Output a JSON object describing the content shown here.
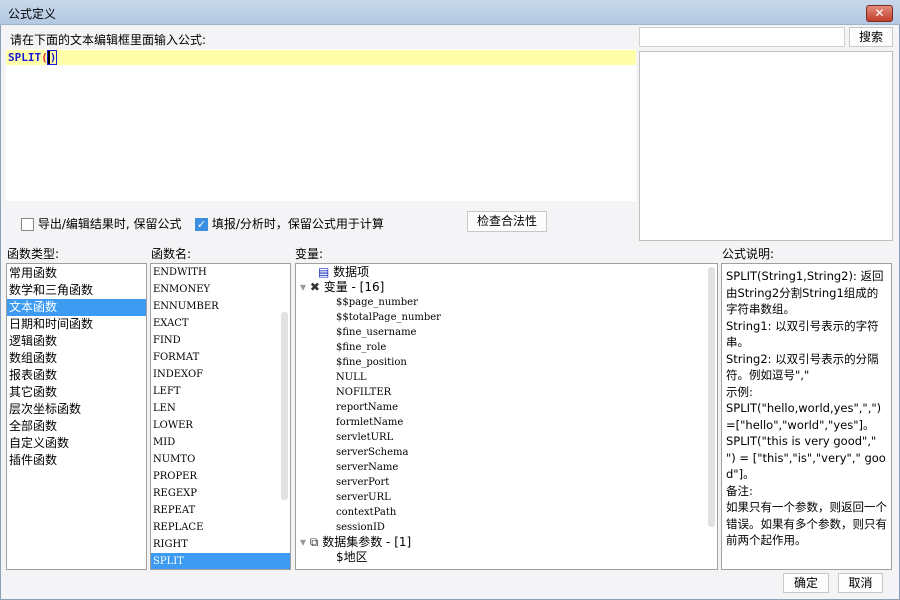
{
  "window": {
    "title": "公式定义",
    "close_icon": "close-icon"
  },
  "editor": {
    "label": "请在下面的文本编辑框里面输入公式:",
    "formula_name": "SPLIT",
    "formula_open": "(",
    "formula_close": ")"
  },
  "search": {
    "value": "",
    "button": "搜索"
  },
  "options": {
    "keep_formula_export": {
      "label": "导出/编辑结果时, 保留公式",
      "checked": false
    },
    "keep_formula_fill": {
      "label": "填报/分析时，保留公式用于计算",
      "checked": true
    },
    "check_button": "检查合法性"
  },
  "labels": {
    "func_type": "函数类型:",
    "func_name": "函数名:",
    "variables": "变量:",
    "description": "公式说明:"
  },
  "func_types": [
    "常用函数",
    "数学和三角函数",
    "文本函数",
    "日期和时间函数",
    "逻辑函数",
    "数组函数",
    "报表函数",
    "其它函数",
    "层次坐标函数",
    "全部函数",
    "自定义函数",
    "插件函数"
  ],
  "func_types_selected": 2,
  "func_names": [
    "ENDWITH",
    "ENMONEY",
    "ENNUMBER",
    "EXACT",
    "FIND",
    "FORMAT",
    "INDEXOF",
    "LEFT",
    "LEN",
    "LOWER",
    "MID",
    "NUMTO",
    "PROPER",
    "REGEXP",
    "REPEAT",
    "REPLACE",
    "RIGHT",
    "SPLIT"
  ],
  "func_names_selected": 17,
  "tree": {
    "data_items": "数据项",
    "variables_group": "变量 - [16]",
    "variables": [
      "$$page_number",
      "$$totalPage_number",
      "$fine_username",
      "$fine_role",
      "$fine_position",
      "NULL",
      "NOFILTER",
      "reportName",
      "formletName",
      "servletURL",
      "serverSchema",
      "serverName",
      "serverPort",
      "serverURL",
      "contextPath",
      "sessionID"
    ],
    "dataset_group": "数据集参数 - [1]",
    "dataset_params": [
      "$地区"
    ]
  },
  "description": [
    "SPLIT(String1,String2): 返回由String2分割String1组成的字符串数组。",
    "String1: 以双引号表示的字符串。",
    "String2: 以双引号表示的分隔符。例如逗号\",\"",
    "示例:",
    "SPLIT(\"hello,world,yes\",\",\")=[\"hello\",\"world\",\"yes\"]。",
    "SPLIT(\"this is very good\",\" \") = [\"this\",\"is\",\"very\",\" good\"]。",
    "备注:",
    "如果只有一个参数，则返回一个错误。如果有多个参数，则只有前两个起作用。"
  ],
  "buttons": {
    "ok": "确定",
    "cancel": "取消"
  }
}
